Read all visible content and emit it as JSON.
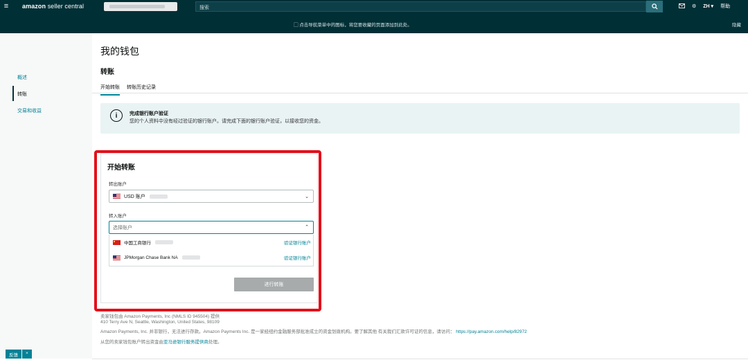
{
  "header": {
    "logo_bold": "amazon",
    "logo_light": " seller central",
    "search_placeholder": "搜索",
    "language": "ZH ▾",
    "help": "帮助"
  },
  "notice": {
    "message": "▢  点击导航菜单中的图标，将您要收藏的页面添加到此处。",
    "hide": "隐藏"
  },
  "sidebar": {
    "items": [
      {
        "label": "概述"
      },
      {
        "label": "转账"
      },
      {
        "label": "交易和收益"
      }
    ]
  },
  "main": {
    "page_title": "我的钱包",
    "section_title": "转账",
    "tabs": [
      {
        "label": "开始转账"
      },
      {
        "label": "转账历史记录"
      }
    ],
    "alert": {
      "title": "完成银行账户验证",
      "text": "您的个人资料中没有经过验证的银行账户。请完成下面的银行账户验证，以接收您的资金。"
    }
  },
  "transfer": {
    "title": "开始转账",
    "from_label": "转出账户",
    "from_value": "USD 账户",
    "to_label": "转入账户",
    "to_placeholder": "选择账户",
    "options": [
      {
        "bank": "中国工商银行",
        "action": "验证银行账户",
        "flag": "cn"
      },
      {
        "bank": "JPMorgan Chase Bank NA",
        "action": "验证银行账户",
        "flag": "us"
      }
    ],
    "submit_label": "进行转账"
  },
  "footer": {
    "line1": "卖家钱包由 Amazon Payments, Inc (NMLS ID 945504) 提供",
    "line2": "410 Terry Ave N, Seattle, Washington, United States, 98109",
    "line3": "Amazon Payments, Inc. 并非银行，无法进行存款。Amazon Payments Inc. 是一家经纽约金融服务部批准成立的资金划拨机构。要了解其他 有关我们汇款许可证的信息，请访问：",
    "line3_link": "https://pay.amazon.com/help/82972",
    "line4_prefix": "从您的卖家钱包账户转出资金由",
    "line4_link": "亚马逊银行服务提供商",
    "line4_suffix": "处理。"
  },
  "feedback": {
    "label": "反馈",
    "close": "×"
  },
  "icons": {
    "menu": "hamburger-icon",
    "search": "search-icon",
    "mail": "mail-icon",
    "settings": "gear-icon",
    "info": "info-icon",
    "caret": "chevron-icon"
  },
  "colors": {
    "nav": "#002f36",
    "accent": "#008296",
    "highlight_frame": "#e3101b",
    "alert_bg": "#e9f3f4",
    "button_disabled": "#a7abac"
  }
}
